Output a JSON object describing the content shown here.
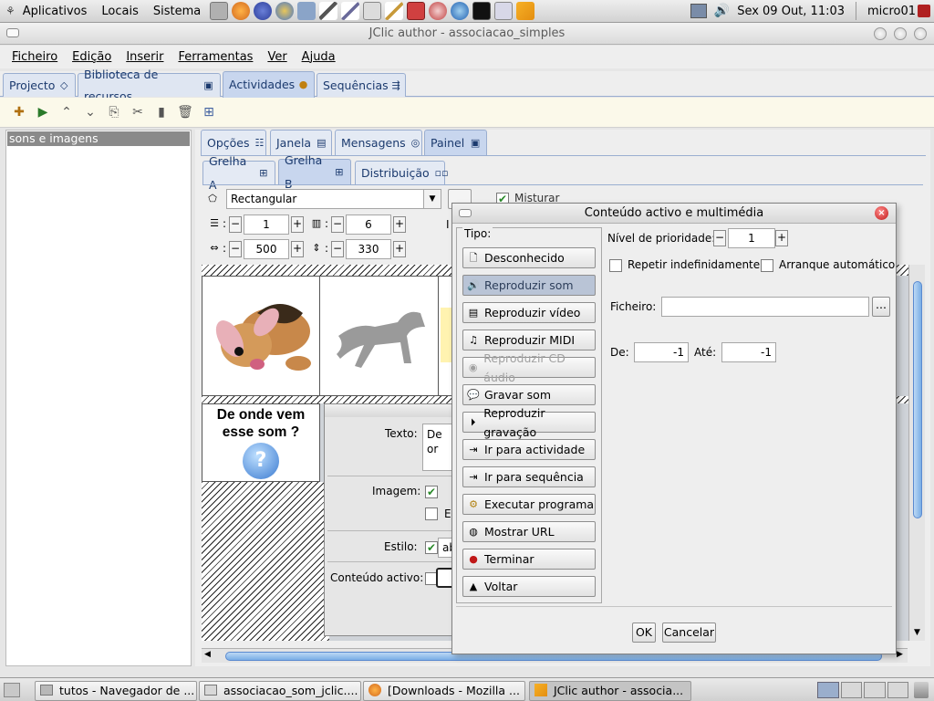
{
  "top_panel": {
    "menus": [
      "Aplicativos",
      "Locais",
      "Sistema"
    ],
    "clock": "Sex 09 Out, 11:03",
    "user": "micro01"
  },
  "window": {
    "title": "JClic author - associacao_simples",
    "menu": [
      "Ficheiro",
      "Edição",
      "Inserir",
      "Ferramentas",
      "Ver",
      "Ajuda"
    ],
    "tabs": [
      "Projecto",
      "Biblioteca de recursos",
      "Actividades",
      "Sequências"
    ],
    "active_tab": "Actividades"
  },
  "left_panel": {
    "selected_item": "sons e imagens"
  },
  "sub_tabs": [
    "Opções",
    "Janela",
    "Mensagens",
    "Painel"
  ],
  "grid_tabs": [
    "Grelha A",
    "Grelha B",
    "Distribuição"
  ],
  "panel_form": {
    "shape": "Rectangular",
    "mix_label": "Misturar",
    "rows": "1",
    "cols": "6",
    "width": "500",
    "height": "330",
    "cell_text": "De onde vem esse som ?",
    "cell_question": "?",
    "partial_label": "I"
  },
  "cell_editor": {
    "texto_label": "Texto:",
    "texto_value": "De or",
    "imagem_label": "Imagem:",
    "e_label": "E",
    "estilo_label": "Estilo:",
    "estilo_value": "ab",
    "conteudo_label": "Conteúdo activo:"
  },
  "dialog": {
    "title": "Conteúdo activo e multimédia",
    "tipo_label": "Tipo:",
    "types": [
      {
        "label": "Desconhecido",
        "icon": "document-icon",
        "state": "normal"
      },
      {
        "label": "Reproduzir som",
        "icon": "speaker-icon",
        "state": "selected"
      },
      {
        "label": "Reproduzir vídeo",
        "icon": "film-icon",
        "state": "normal"
      },
      {
        "label": "Reproduzir MIDI",
        "icon": "music-note-icon",
        "state": "normal"
      },
      {
        "label": "Reproduzir CD áudio",
        "icon": "cd-icon",
        "state": "disabled"
      },
      {
        "label": "Gravar som",
        "icon": "speech-bubble-icon",
        "state": "normal"
      },
      {
        "label": "Reproduzir gravação",
        "icon": "playback-icon",
        "state": "normal"
      },
      {
        "label": "Ir para actividade",
        "icon": "goto-activity-icon",
        "state": "normal"
      },
      {
        "label": "Ir para sequência",
        "icon": "goto-sequence-icon",
        "state": "normal"
      },
      {
        "label": "Executar programa",
        "icon": "gear-icon",
        "state": "normal"
      },
      {
        "label": "Mostrar URL",
        "icon": "globe-icon",
        "state": "normal"
      },
      {
        "label": "Terminar",
        "icon": "stop-icon",
        "state": "normal"
      },
      {
        "label": "Voltar",
        "icon": "back-arrow-icon",
        "state": "normal"
      }
    ],
    "priority_label": "Nível de prioridade:",
    "priority_value": "1",
    "repeat_label": "Repetir indefinidamente",
    "autostart_label": "Arranque automático",
    "file_label": "Ficheiro:",
    "file_value": "",
    "browse_label": "...",
    "from_label": "De:",
    "from_value": "-1",
    "to_label": "Até:",
    "to_value": "-1",
    "ok_label": "OK",
    "cancel_label": "Cancelar"
  },
  "taskbar": [
    {
      "label": "tutos - Navegador de ...",
      "active": false
    },
    {
      "label": "associacao_som_jclic....",
      "active": false
    },
    {
      "label": "[Downloads - Mozilla ...",
      "active": false
    },
    {
      "label": "JClic author - associa...",
      "active": true
    }
  ]
}
